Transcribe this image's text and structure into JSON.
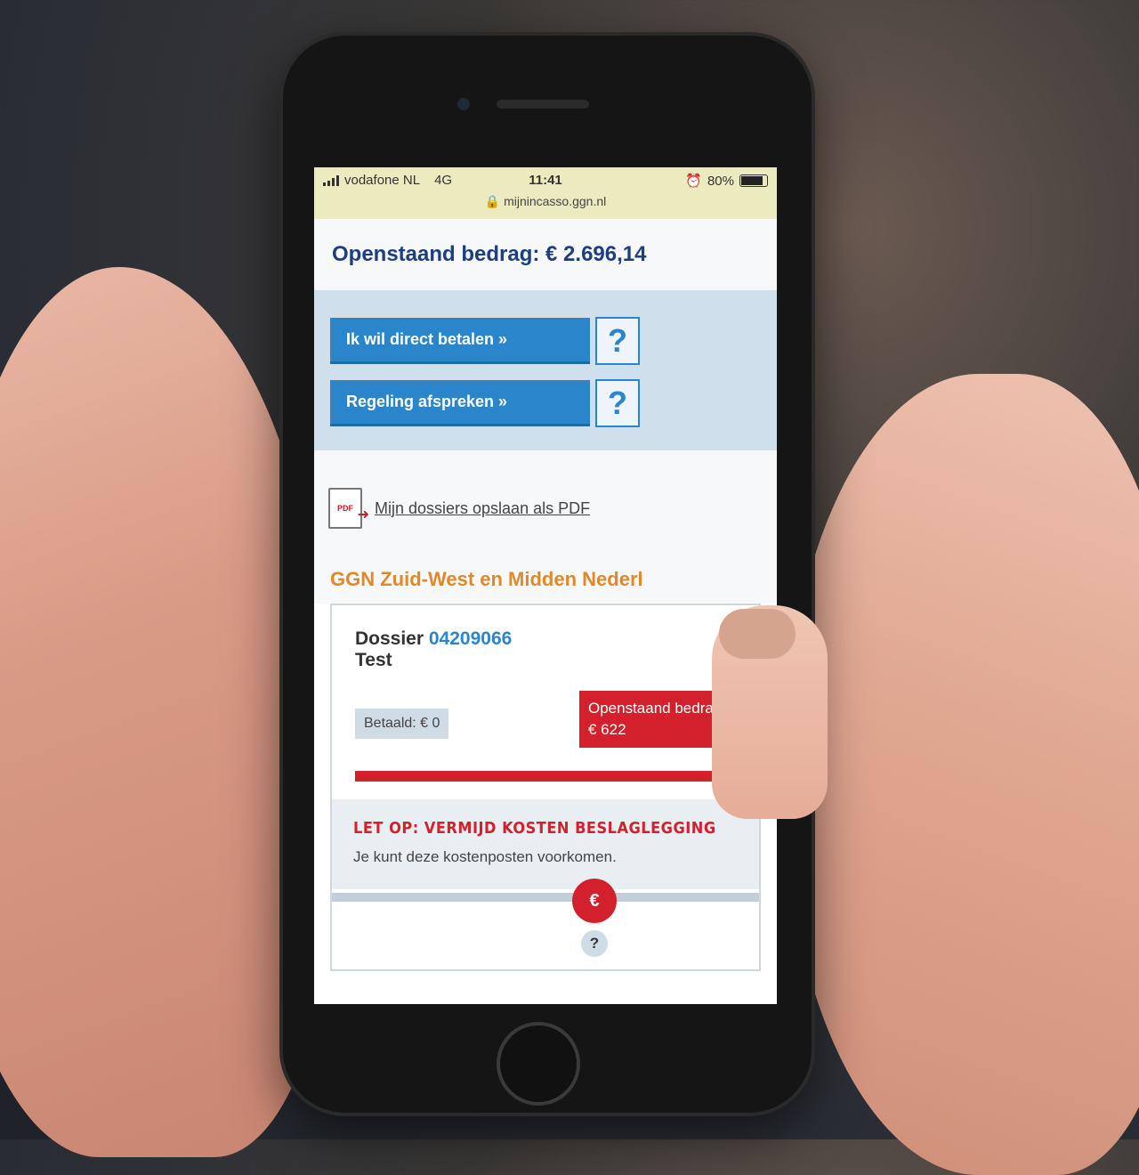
{
  "status_bar": {
    "carrier": "vodafone NL",
    "network": "4G",
    "time": "11:41",
    "battery": "80%",
    "url": "mijnincasso.ggn.nl"
  },
  "header": {
    "title": "Openstaand bedrag: € 2.696,14"
  },
  "actions": [
    {
      "label": "Ik wil direct betalen »",
      "help": "?"
    },
    {
      "label": "Regeling afspreken »",
      "help": "?"
    }
  ],
  "pdf": {
    "icon_label": "PDF",
    "link": "Mijn dossiers opslaan als PDF"
  },
  "org": {
    "title": "GGN Zuid-West en Midden Nederl"
  },
  "dossier": {
    "label": "Dossier",
    "number": "04209066",
    "name": "Test",
    "paid": "Betaald: € 0",
    "open_label": "Openstaand bedrag:",
    "open_amount": "€ 622",
    "paid_fraction": 0
  },
  "warning": {
    "title": "LET OP: VERMIJD KOSTEN BESLAGLEGGING",
    "text": "Je kunt deze kostenposten voorkomen."
  },
  "bottom": {
    "euro_icon": "€",
    "help": "?"
  },
  "colors": {
    "primary_blue": "#2a85cb",
    "navy": "#1d3f82",
    "accent_orange": "#e0892a",
    "alert_red": "#d2202d"
  }
}
